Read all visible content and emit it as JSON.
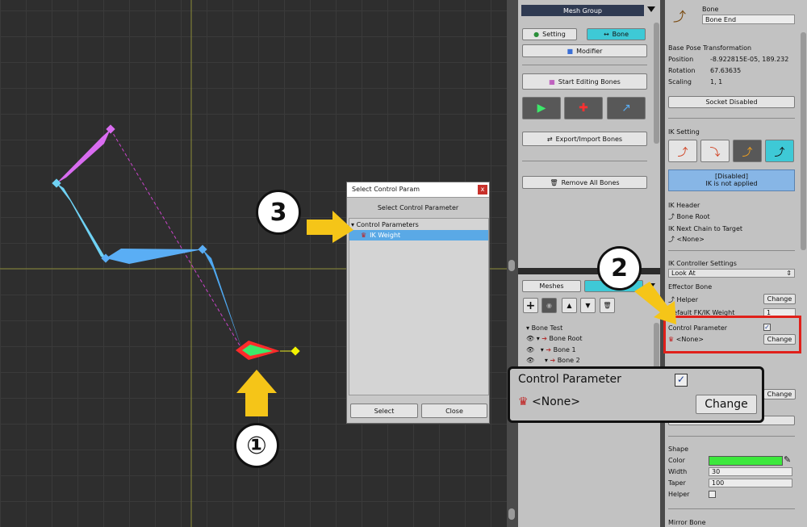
{
  "mid_top": {
    "header": "Mesh Group",
    "tab_setting": "Setting",
    "tab_bone": "Bone",
    "modifier": "Modifier",
    "start_editing": "Start Editing Bones",
    "export_import": "Export/Import Bones",
    "remove_all": "Remove All Bones"
  },
  "mid_bot": {
    "tab_meshes": "Meshes",
    "tree": [
      "Bone Test",
      "Bone Root",
      "Bone 1",
      "Bone 2"
    ]
  },
  "right": {
    "bone_label": "Bone",
    "bone_name": "Bone End",
    "base_pose": "Base Pose Transformation",
    "position_label": "Position",
    "position_value": "-8.922815E-05, 189.232",
    "rotation_label": "Rotation",
    "rotation_value": "67.63635",
    "scaling_label": "Scaling",
    "scaling_value": "1, 1",
    "socket": "Socket Disabled",
    "ik_setting": "IK Setting",
    "disabled_line1": "[Disabled]",
    "disabled_line2": "IK is not applied",
    "ik_header": "IK Header",
    "ik_header_value": "Bone Root",
    "ik_next": "IK Next Chain to Target",
    "ik_next_value": "<None>",
    "ik_controller": "IK Controller Settings",
    "look_at": "Look At",
    "effector": "Effector Bone",
    "helper_value": "Helper",
    "change": "Change",
    "default_fk": "Default FK/IK Weight",
    "default_fk_value": "1",
    "control_param": "Control Parameter",
    "none": "<None>",
    "shape": "Shape",
    "color_label": "Color",
    "width_label": "Width",
    "width_value": "30",
    "taper_label": "Taper",
    "taper_value": "100",
    "helper_label": "Helper",
    "mirror_bone": "Mirror Bone"
  },
  "dialog": {
    "title": "Select Control Param",
    "header": "Select Control Parameter",
    "group": "Control Parameters",
    "item": "IK Weight",
    "select": "Select",
    "close": "Close"
  },
  "zoom": {
    "title": "Control Parameter",
    "none": "<None>",
    "change": "Change"
  },
  "steps": [
    "①",
    "2",
    "3"
  ],
  "colors": {
    "accent_blue": "#3ec9d6",
    "highlight_red": "#e0201a",
    "arrow_yellow": "#f5c518",
    "disabled_box": "#87b6e6"
  }
}
